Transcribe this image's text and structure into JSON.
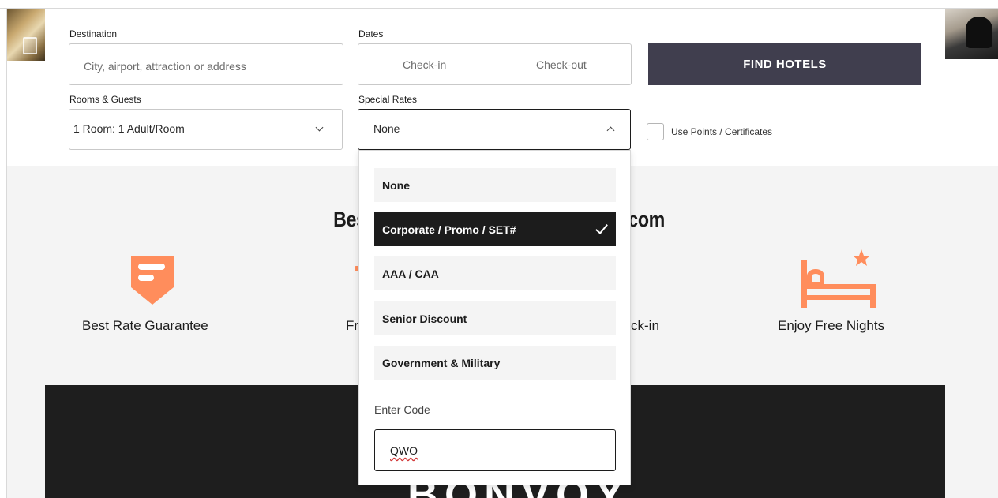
{
  "search_form": {
    "destination_label": "Destination",
    "destination_placeholder": "City, airport, attraction or address",
    "dates_label": "Dates",
    "checkin_placeholder": "Check-in",
    "checkout_placeholder": "Check-out",
    "find_button": "FIND HOTELS",
    "rooms_label": "Rooms & Guests",
    "rooms_value": "1 Room: 1 Adult/Room",
    "special_rates_label": "Special Rates",
    "special_rates_value": "None",
    "use_points_label": "Use Points / Certificates",
    "use_points_checked": false
  },
  "special_rates_dropdown": {
    "options": [
      {
        "label": "None",
        "selected": false
      },
      {
        "label": "Corporate / Promo / SET#",
        "selected": true
      },
      {
        "label": "AAA / CAA",
        "selected": false
      },
      {
        "label": "Senior Discount",
        "selected": false
      },
      {
        "label": "Government & Military",
        "selected": false
      }
    ],
    "enter_code_label": "Enter Code",
    "code_value": "QWO"
  },
  "benefits": {
    "title_left": "Best",
    "title_right": "t.com",
    "items": [
      {
        "label": "Best Rate Guarantee",
        "icon": "price-tag-shield-icon"
      },
      {
        "label": "Fr",
        "icon": "partially-hidden-icon"
      },
      {
        "label": "ck-in",
        "icon": "partially-hidden-icon"
      },
      {
        "label": "Enjoy Free Nights",
        "icon": "bed-star-icon"
      }
    ]
  },
  "banner": {
    "logo_text": "BONVOY"
  },
  "colors": {
    "accent": "#ff8d5c",
    "button_bg": "#403e4e",
    "selected_bg": "#1c1c1c",
    "section_bg": "#f4f4f4",
    "banner_bg": "#1e1e1e"
  }
}
